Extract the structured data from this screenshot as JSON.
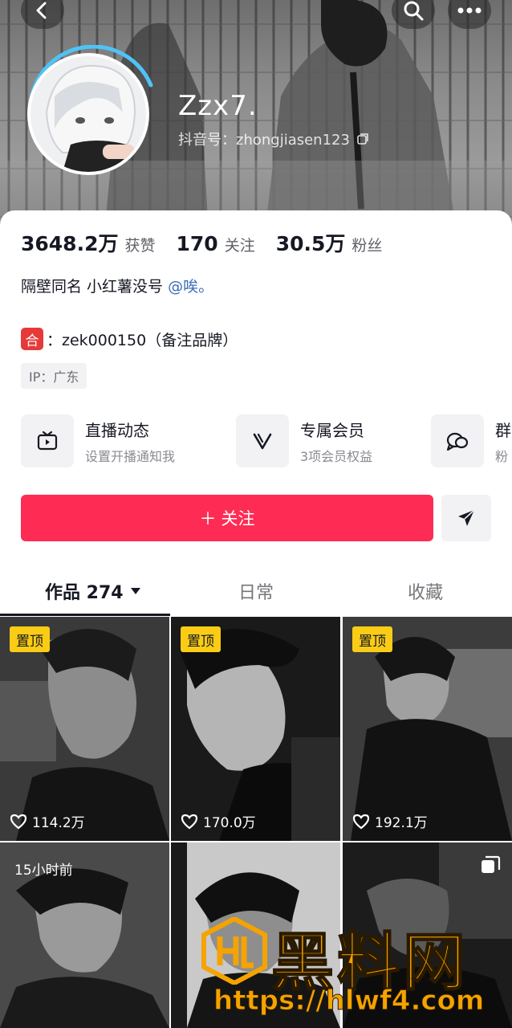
{
  "header": {
    "nickname": "Zzx7.",
    "douyin_id": "抖音号：zhongjiasen123"
  },
  "stats": [
    {
      "value": "3648.2万",
      "label": "获赞"
    },
    {
      "value": "170",
      "label": "关注"
    },
    {
      "value": "30.5万",
      "label": "粉丝"
    }
  ],
  "bio": {
    "text": "隔壁同名 小红薯没号 ",
    "mention": "@唉。"
  },
  "contact": {
    "badge": "合",
    "text": "：zek000150（备注品牌）"
  },
  "ip": "IP：广东",
  "services": [
    {
      "title": "直播动态",
      "subtitle": "设置开播通知我",
      "icon": "tv-icon"
    },
    {
      "title": "专属会员",
      "subtitle": "3项会员权益",
      "icon": "v-icon"
    },
    {
      "title": "群",
      "subtitle": "粉",
      "icon": "chat-icon"
    }
  ],
  "actions": {
    "follow_label": "关注",
    "follow_plus": "＋"
  },
  "tabs": {
    "works": "作品 274",
    "daily": "日常",
    "favorites": "收藏"
  },
  "videos": [
    {
      "badge": "置顶",
      "likes": "114.2万"
    },
    {
      "badge": "置顶",
      "likes": "170.0万"
    },
    {
      "badge": "置顶",
      "likes": "192.1万"
    },
    {
      "time": "15小时前"
    },
    {},
    {}
  ],
  "watermark": {
    "text": "黑料网",
    "url": "https://hlwf4.com"
  },
  "colors": {
    "primary": "#fe2c55",
    "pin": "#facc15",
    "mention": "#3b6db8"
  }
}
